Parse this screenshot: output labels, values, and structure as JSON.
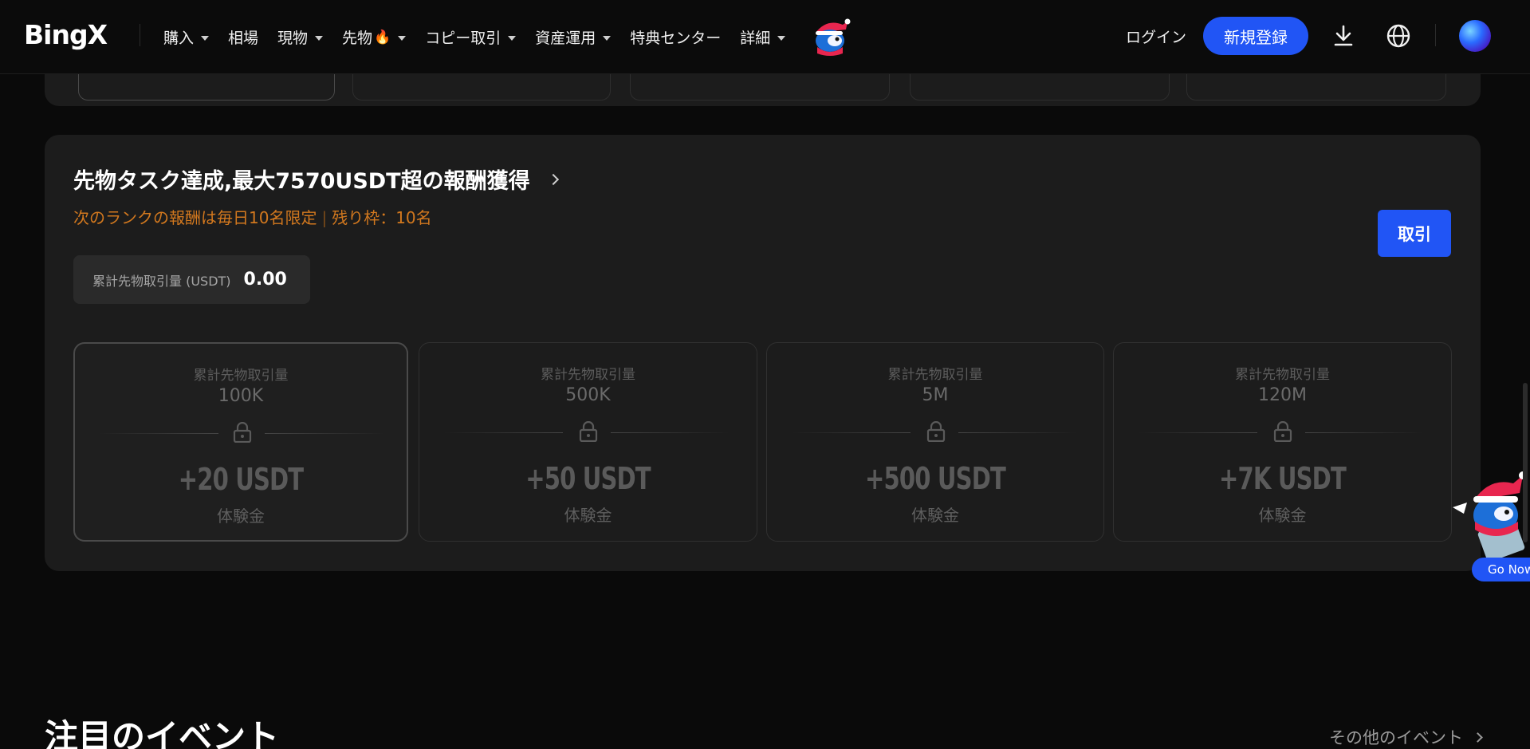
{
  "nav": {
    "logo": "BingX",
    "items": [
      {
        "label": "購入",
        "dropdown": true
      },
      {
        "label": "相場",
        "dropdown": false
      },
      {
        "label": "現物",
        "dropdown": true
      },
      {
        "label": "先物",
        "dropdown": true,
        "badge": "🔥"
      },
      {
        "label": "コピー取引",
        "dropdown": true
      },
      {
        "label": "資産運用",
        "dropdown": true
      },
      {
        "label": "特典センター",
        "dropdown": false
      },
      {
        "label": "詳細",
        "dropdown": true
      }
    ],
    "login": "ログイン",
    "signup": "新規登録"
  },
  "task": {
    "title": "先物タスク達成,最大7570USDT超の報酬獲得",
    "notice_left": "次のランクの報酬は毎日10名限定",
    "notice_sep": "|",
    "notice_right": "残り枠：10名",
    "trade_button": "取引",
    "volume_label": "累計先物取引量 (USDT)",
    "volume_value": "0.00",
    "tiers": [
      {
        "label": "累計先物取引量",
        "amount": "100K",
        "reward": "+20 USDT",
        "reward_sub": "体験金",
        "active": true
      },
      {
        "label": "累計先物取引量",
        "amount": "500K",
        "reward": "+50 USDT",
        "reward_sub": "体験金",
        "active": false
      },
      {
        "label": "累計先物取引量",
        "amount": "5M",
        "reward": "+500 USDT",
        "reward_sub": "体験金",
        "active": false
      },
      {
        "label": "累計先物取引量",
        "amount": "120M",
        "reward": "+7K USDT",
        "reward_sub": "体験金",
        "active": false
      }
    ]
  },
  "floating": {
    "go_now": "Go Now"
  },
  "events": {
    "title": "注目のイベント",
    "more": "その他のイベント"
  },
  "colors": {
    "accent": "#2155f5",
    "orange": "#d2781e",
    "card": "#1c1c1c",
    "background": "#0a0a0a"
  }
}
